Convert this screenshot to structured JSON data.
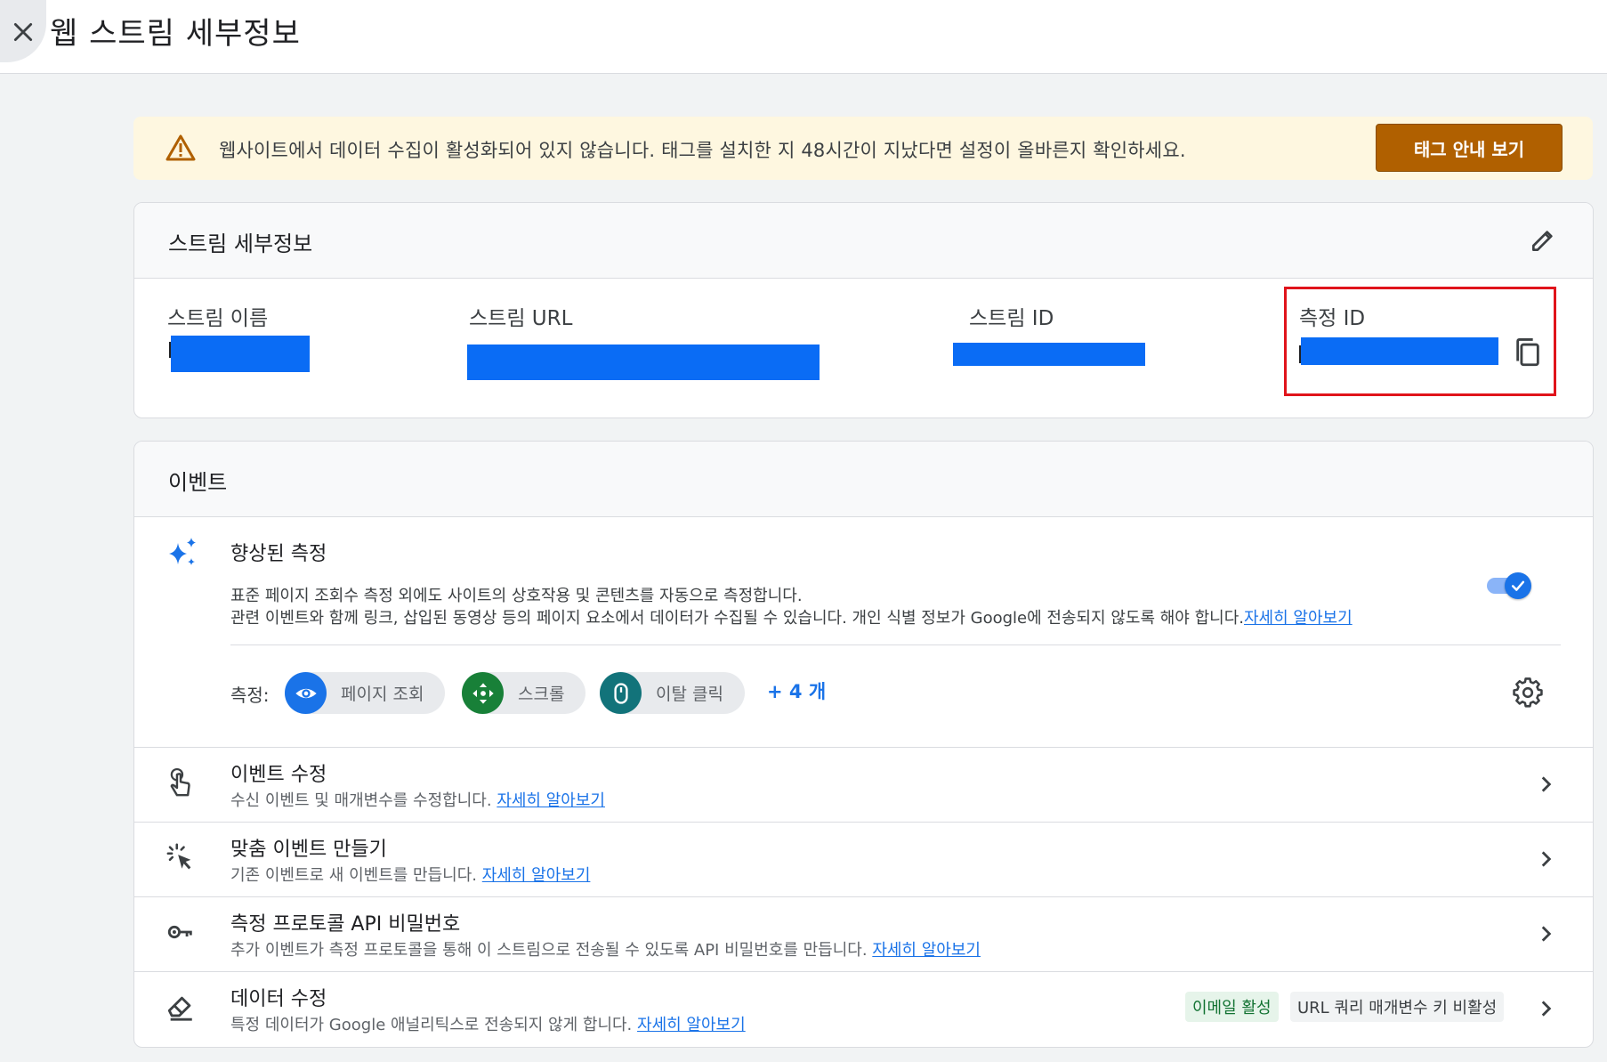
{
  "header": {
    "title": "웹 스트림 세부정보",
    "close_icon": "close-icon"
  },
  "alert": {
    "icon": "warning-icon",
    "text": "웹사이트에서 데이터 수집이 활성화되어 있지 않습니다. 태그를 설치한 지 48시간이 지났다면 설정이 올바른지 확인하세요.",
    "button_label": "태그 안내 보기",
    "colors": {
      "background": "#fef7e0",
      "button": "#b06000"
    }
  },
  "stream_details": {
    "title": "스트림 세부정보",
    "edit_icon": "pencil-icon",
    "fields": [
      {
        "label": "스트림 이름",
        "value_redacted": true
      },
      {
        "label": "스트림 URL",
        "value_redacted": true
      },
      {
        "label": "스트림 ID",
        "value_redacted": true
      },
      {
        "label": "측정 ID",
        "value_redacted": true,
        "highlighted": true
      }
    ],
    "copy_icon": "copy-icon",
    "redaction_color": "#0a6cf5",
    "highlight_color": "#e0141b"
  },
  "events": {
    "title": "이벤트",
    "enhanced": {
      "icon": "sparkle-icon",
      "title": "향상된 측정",
      "desc_line1": "표준 페이지 조회수 측정 외에도 사이트의 상호작용 및 콘텐츠를 자동으로 측정합니다.",
      "desc_line2": "관련 이벤트와 함께 링크, 삽입된 동영상 등의 페이지 요소에서 데이터가 수집될 수 있습니다. 개인 식별 정보가 Google에 전송되지 않도록 해야 합니다.",
      "learn_more": "자세히 알아보기",
      "toggle_on": true
    },
    "measurement_label": "측정:",
    "chips": [
      {
        "label": "페이지 조회",
        "icon": "eye-icon",
        "color": "#1a73e8"
      },
      {
        "label": "스크롤",
        "icon": "scroll-arrows-icon",
        "color": "#188038"
      },
      {
        "label": "이탈 클릭",
        "icon": "mouse-icon",
        "color": "#12737a"
      }
    ],
    "more_chips": "+ 4 개",
    "settings_icon": "gear-icon",
    "rows": [
      {
        "icon": "touch-hand-icon",
        "title": "이벤트 수정",
        "desc": "수신 이벤트 및 매개변수를 수정합니다.",
        "link": "자세히 알아보기"
      },
      {
        "icon": "cursor-click-icon",
        "title": "맞춤 이벤트 만들기",
        "desc": "기존 이벤트로 새 이벤트를 만듭니다.",
        "link": "자세히 알아보기"
      },
      {
        "icon": "key-icon",
        "title": "측정 프로토콜 API 비밀번호",
        "desc": "추가 이벤트가 측정 프로토콜을 통해 이 스트림으로 전송될 수 있도록 API 비밀번호를 만듭니다.",
        "link": "자세히 알아보기"
      },
      {
        "icon": "eraser-icon",
        "title": "데이터 수정",
        "desc": "특정 데이터가 Google 애널리틱스로 전송되지 않게 합니다.",
        "link": "자세히 알아보기",
        "badges": [
          "이메일 활성",
          "URL 쿼리 매개변수 키 비활성"
        ]
      }
    ]
  }
}
